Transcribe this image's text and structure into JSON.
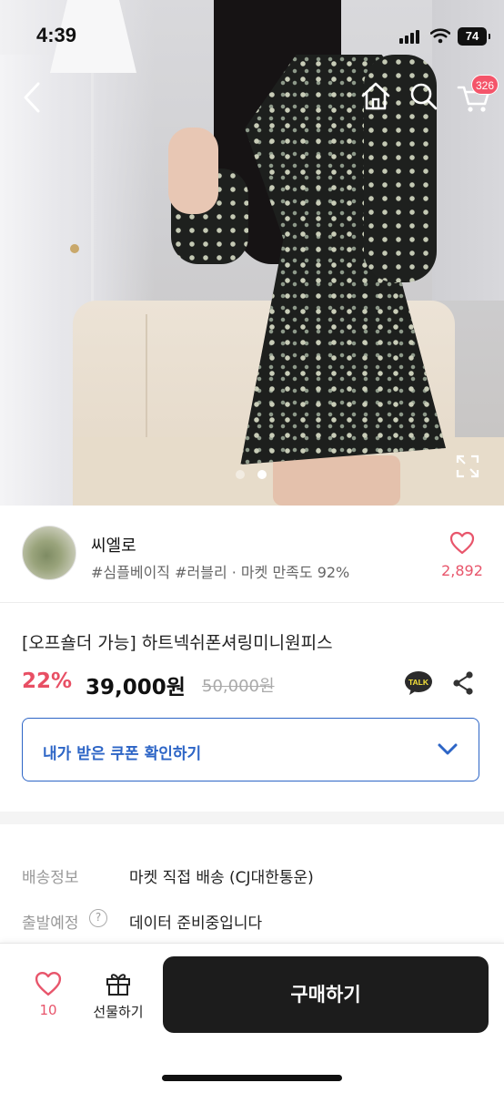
{
  "status_bar": {
    "time": "4:39",
    "battery": "74"
  },
  "header": {
    "back_icon": "chevron-left-icon",
    "home_icon": "home-icon",
    "search_icon": "search-icon",
    "cart_icon": "cart-icon",
    "cart_badge": "326"
  },
  "gallery": {
    "page_count": 2,
    "active_index": 1,
    "expand_icon": "expand-icon"
  },
  "seller": {
    "name": "씨엘로",
    "tags": "#심플베이직 #러블리 · 마켓 만족도 92%",
    "like_count": "2,892",
    "heart_icon": "heart-outline-icon"
  },
  "product": {
    "title": "[오프숄더 가능] 하트넥쉬폰셔링미니원피스",
    "discount": "22%",
    "price": "39,000원",
    "original_price": "50,000원",
    "talk_label": "TALK",
    "share_icon": "share-icon"
  },
  "coupon": {
    "label": "내가 받은 쿠폰 확인하기",
    "chevron_icon": "chevron-down-icon"
  },
  "shipping": [
    {
      "label": "배송정보",
      "value": "마켓 직접 배송 (CJ대한통운)"
    },
    {
      "label": "출발예정",
      "value": "데이터 준비중입니다",
      "help": "?"
    }
  ],
  "bottom_bar": {
    "like_count": "10",
    "gift_label": "선물하기",
    "buy_label": "구매하기"
  },
  "colors": {
    "accent_red": "#e84f64",
    "coupon_blue": "#2d65c6",
    "buy_button": "#1c1c1c",
    "badge": "#f4556a"
  }
}
